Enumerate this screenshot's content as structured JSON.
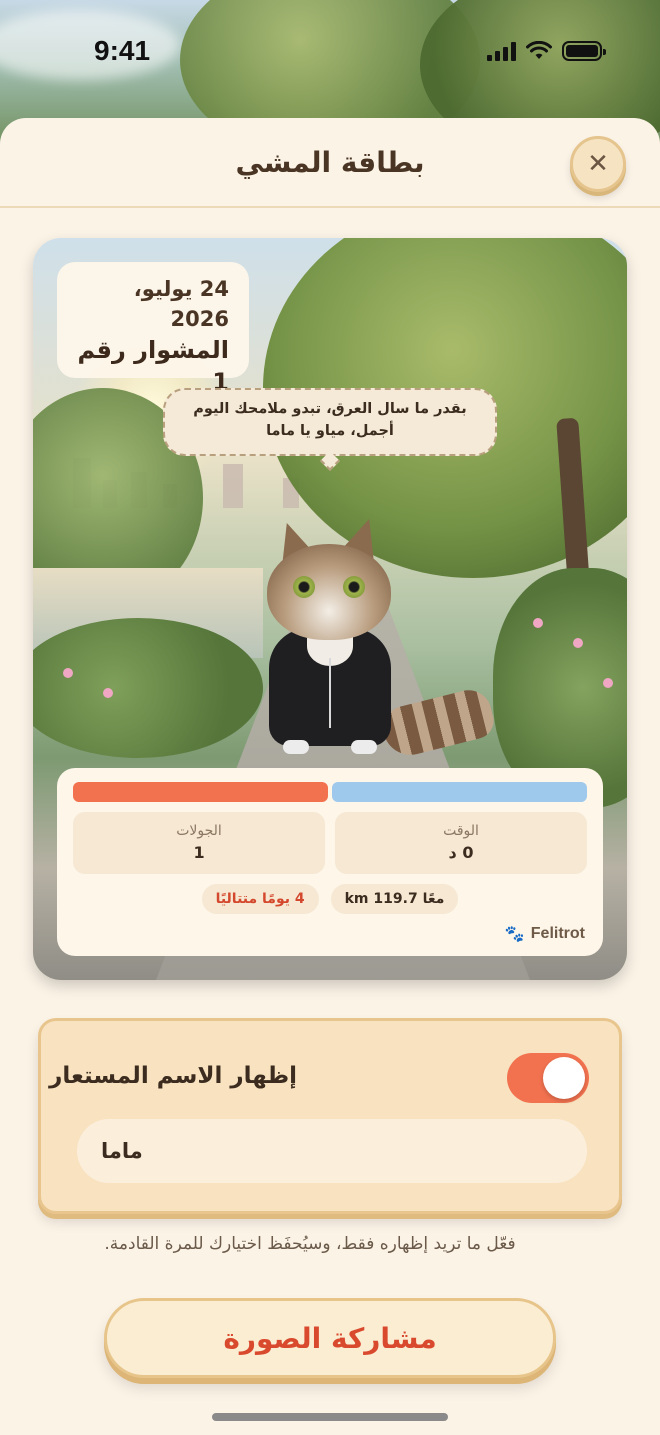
{
  "status_bar": {
    "time": "9:41"
  },
  "sheet": {
    "title": "بطاقة المشي",
    "close_icon": "close-icon"
  },
  "card": {
    "date": "24 يوليو، 2026",
    "walk_title": "المشوار رقم 1",
    "nickname": "ماما",
    "speech": "بقدر ما سال العرق، تبدو ملامحك اليوم أجمل، مياو يا ماما",
    "progress": {
      "orange_fraction": 0.5,
      "blue_fraction": 0.5
    },
    "stats": [
      {
        "label": "الوقت",
        "value": "0 د"
      },
      {
        "label": "الجولات",
        "value": "1"
      }
    ],
    "chips": {
      "distance": "معًا 119.7 km",
      "streak": "4 يومًا متتاليًا"
    },
    "brand": "Felitrot"
  },
  "toggle_section": {
    "label": "إظهار الاسم المستعار",
    "enabled": true,
    "nickname_value": "ماما"
  },
  "hint": "فعّل ما تريد إظهاره فقط، وسيُحفَظ اختيارك للمرة القادمة.",
  "share_button": "مشاركة الصورة",
  "colors": {
    "accent": "#f2724f",
    "secondary": "#9ec8ec",
    "background": "#fbf3e6",
    "text_dark": "#3b2c1f",
    "highlight_red": "#d4482e"
  }
}
